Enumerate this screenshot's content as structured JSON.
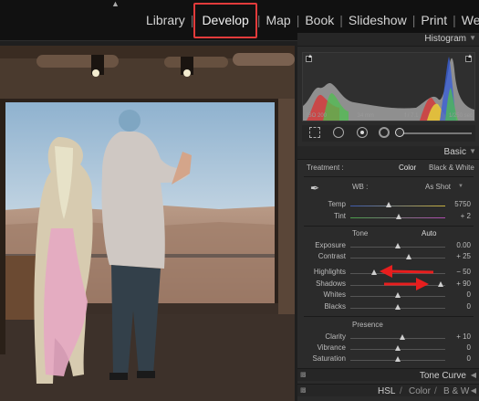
{
  "modules": [
    "Library",
    "Develop",
    "Map",
    "Book",
    "Slideshow",
    "Print",
    "We"
  ],
  "active_module": "Develop",
  "histogram": {
    "title": "Histogram",
    "iso": "ISO 200",
    "focal": "34 mm",
    "aperture": "f / 7.1",
    "shutter": "1/250 sec"
  },
  "basic": {
    "title": "Basic",
    "treatment_label": "Treatment :",
    "treatment_color": "Color",
    "treatment_bw": "Black & White",
    "wb_label": "WB :",
    "wb_value": "As Shot",
    "tone_label": "Tone",
    "auto_label": "Auto",
    "presence_label": "Presence",
    "sliders": {
      "temp": {
        "label": "Temp",
        "value": "5750",
        "fraction": 0.4
      },
      "tint": {
        "label": "Tint",
        "value": "+ 2",
        "fraction": 0.51
      },
      "exposure": {
        "label": "Exposure",
        "value": "0.00",
        "fraction": 0.5
      },
      "contrast": {
        "label": "Contrast",
        "value": "+ 25",
        "fraction": 0.62
      },
      "highlights": {
        "label": "Highlights",
        "value": "− 50",
        "fraction": 0.25
      },
      "shadows": {
        "label": "Shadows",
        "value": "+ 90",
        "fraction": 0.95
      },
      "whites": {
        "label": "Whites",
        "value": "0",
        "fraction": 0.5
      },
      "blacks": {
        "label": "Blacks",
        "value": "0",
        "fraction": 0.5
      },
      "clarity": {
        "label": "Clarity",
        "value": "+ 10",
        "fraction": 0.55
      },
      "vibrance": {
        "label": "Vibrance",
        "value": "0",
        "fraction": 0.5
      },
      "saturation": {
        "label": "Saturation",
        "value": "0",
        "fraction": 0.5
      }
    }
  },
  "tone_curve_label": "Tone Curve",
  "hsl_tabs": {
    "hsl": "HSL",
    "color": "Color",
    "bw": "B & W",
    "divider": "/"
  },
  "colors": {
    "accent_red": "#e23b3b",
    "panel": "#2b2b2b",
    "background": "#111111"
  }
}
